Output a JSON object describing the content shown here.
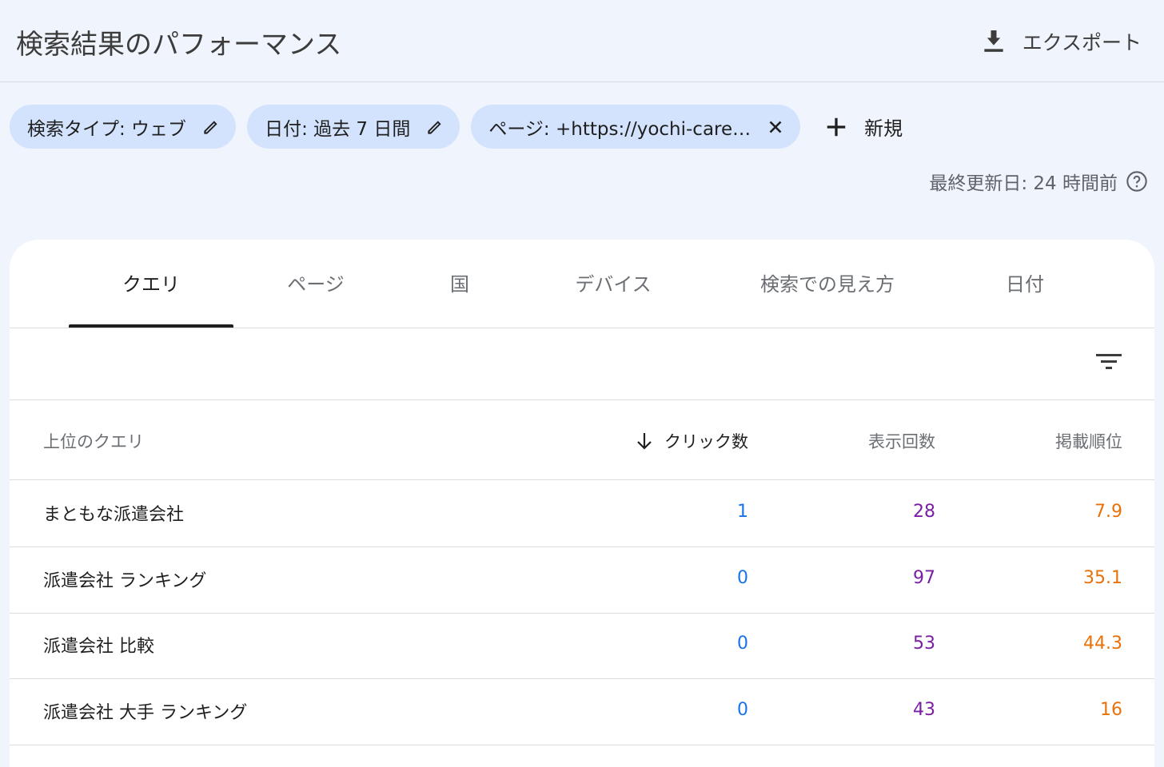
{
  "header": {
    "title": "検索結果のパフォーマンス",
    "export_label": "エクスポート",
    "export_icon": "download-icon"
  },
  "filters": {
    "chips": [
      {
        "label": "検索タイプ: ウェブ",
        "icon": "edit-icon"
      },
      {
        "label": "日付: 過去 7 日間",
        "icon": "edit-icon"
      },
      {
        "label": "ページ: +https://yochi-care…",
        "icon": "close-icon"
      }
    ],
    "new_label": "新規"
  },
  "last_updated": "最終更新日: 24 時間前",
  "tabs": [
    "クエリ",
    "ページ",
    "国",
    "デバイス",
    "検索での見え方",
    "日付"
  ],
  "active_tab": "クエリ",
  "table": {
    "columns": {
      "query": "上位のクエリ",
      "clicks": "クリック数",
      "impressions": "表示回数",
      "position": "掲載順位"
    },
    "sorted_by": "clicks",
    "rows": [
      {
        "query": "まともな派遣会社",
        "clicks": "1",
        "impressions": "28",
        "position": "7.9"
      },
      {
        "query": "派遣会社 ランキング",
        "clicks": "0",
        "impressions": "97",
        "position": "35.1"
      },
      {
        "query": "派遣会社 比較",
        "clicks": "0",
        "impressions": "53",
        "position": "44.3"
      },
      {
        "query": "派遣会社 大手 ランキング",
        "clicks": "0",
        "impressions": "43",
        "position": "16"
      }
    ]
  },
  "colors": {
    "clicks": "#1a73e8",
    "impressions": "#7b1fa2",
    "position": "#e8710a",
    "chip_bg": "#d3e3fd"
  }
}
